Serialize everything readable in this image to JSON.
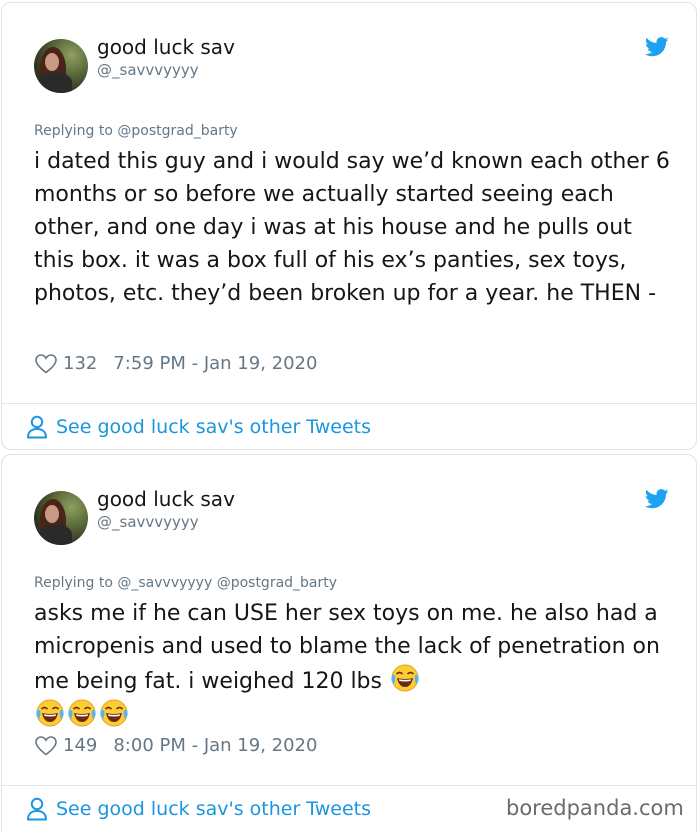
{
  "colors": {
    "link": "#1b95e0",
    "muted": "#657786",
    "text": "#14171a",
    "twitter": "#1da1f2"
  },
  "tweets": [
    {
      "name": "good luck sav",
      "handle": "@_savvvyyyy",
      "replying_to": "Replying to @postgrad_barty",
      "text": "i dated this guy and i would say we’d known each other 6 months or so before we actually started seeing each other, and one day i was at his house and he pulls out this box. it was a box full of his ex’s panties, sex toys, photos, etc. they’d been broken up for a year. he THEN -",
      "likes": "132",
      "timestamp": "7:59 PM - Jan 19, 2020",
      "see_more": "See good luck sav's other Tweets",
      "icons": [
        "avatar",
        "twitter-bird-icon",
        "heart-icon",
        "person-icon"
      ]
    },
    {
      "name": "good luck sav",
      "handle": "@_savvvyyyy",
      "replying_to": "Replying to @_savvvyyyy @postgrad_barty",
      "text": "asks me if he can USE her sex toys on me. he also had a micropenis and used to blame the lack of penetration on me being fat. i weighed 120 lbs",
      "emoji": "face-with-tears-of-joy",
      "likes": "149",
      "timestamp": "8:00 PM - Jan 19, 2020",
      "see_more": "See good luck sav's other Tweets",
      "icons": [
        "avatar",
        "twitter-bird-icon",
        "heart-icon",
        "person-icon",
        "tears-of-joy-emoji-icon"
      ]
    }
  ],
  "watermark": "boredpanda.com"
}
